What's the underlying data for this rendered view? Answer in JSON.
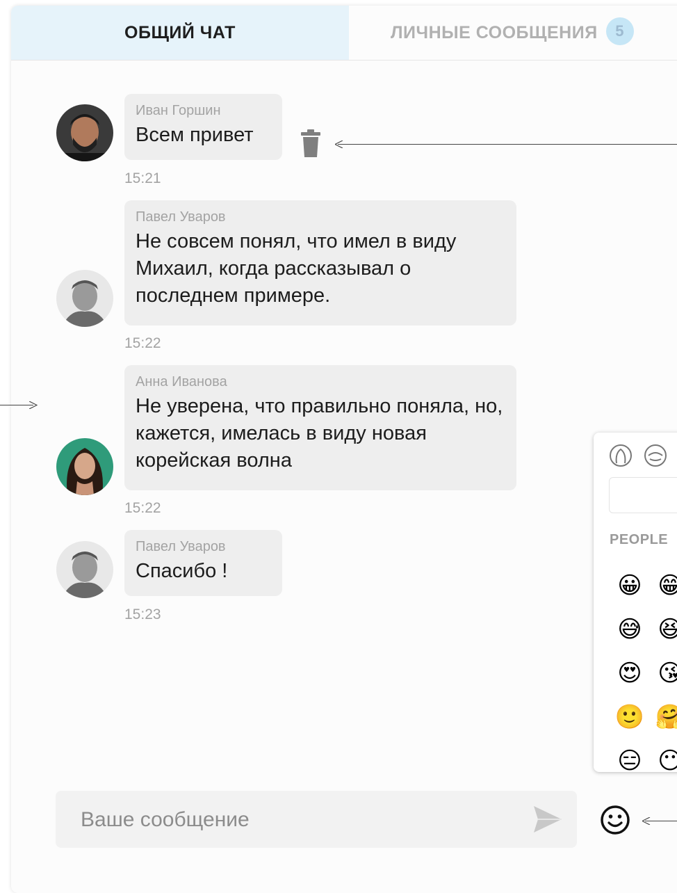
{
  "tabs": {
    "general_chat": "ОБЩИЙ ЧАТ",
    "private_messages": "ЛИЧНЫЕ СООБЩЕНИЯ",
    "private_badge": "5"
  },
  "messages": [
    {
      "author": "Иван Горшин",
      "text": "Всем привет",
      "time": "15:21"
    },
    {
      "author": "Павел Уваров",
      "text": "Не совсем понял, что имел в виду Михаил, когда рассказывал о последнем примере.",
      "time": "15:22"
    },
    {
      "author": "Анна Иванова",
      "text": "Не уверена, что правильно поняла, но, кажется, имелась в виду новая корейская волна",
      "time": "15:22"
    },
    {
      "author": "Павел Уваров",
      "text": "Спасибо !",
      "time": "15:23"
    }
  ],
  "emoji_picker": {
    "category_label": "PEOPLE",
    "emojis": [
      "😀",
      "😁",
      "😅",
      "😆",
      "😍",
      "😘",
      "🙂",
      "🤗",
      "😑",
      "😶"
    ]
  },
  "composer": {
    "placeholder": "Ваше сообщение"
  },
  "colors": {
    "active_tab_bg": "#e6f3fa",
    "bubble_bg": "#eeeeee",
    "muted_text": "#a3a3a3",
    "badge_bg": "#c6e6f6"
  }
}
